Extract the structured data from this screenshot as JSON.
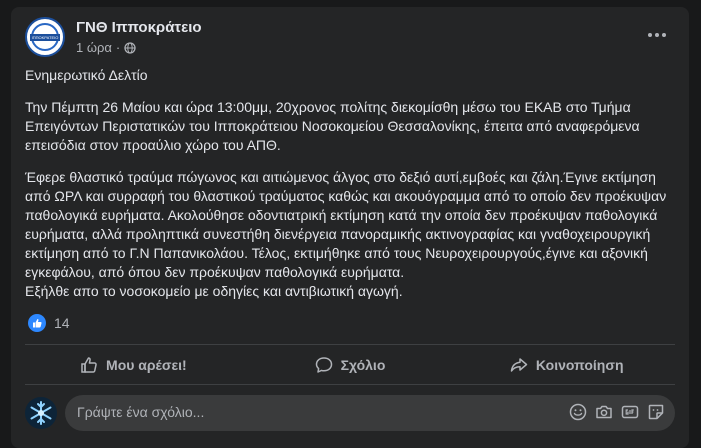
{
  "post": {
    "page_name": "ΓΝΘ Ιπποκράτειο",
    "avatar_text": "ΙΠΠΟΚΡΑΤΕΙΟ",
    "time": "1 ώρα",
    "separator": "·",
    "paragraphs": [
      "Ενημερωτικό Δελτίο",
      "Την Πέμπτη 26 Μαίου και ώρα 13:00μμ, 20χρονος πολίτης διεκομίσθη μέσω του ΕΚΑΒ στο Τμήμα Επειγόντων Περιστατικών του Ιπποκράτειου Νοσοκομείου Θεσσαλονίκης, έπειτα από αναφερόμενα επεισόδια στον προαύλιο χώρο του ΑΠΘ.",
      "Έφερε θλαστικό τραύμα πώγωνος και αιτιώμενος άλγος στο δεξιό αυτί,εμβοές και ζάλη.Έγινε εκτίμηση από ΩΡΛ και συρραφή του θλαστικού τραύματος καθώς και ακουόγραμμα από το οποίο δεν προέκυψαν παθολογικά ευρήματα. Ακολούθησε οδοντιατρική εκτίμηση κατά την οποία δεν προέκυψαν παθολογικά ευρήματα, αλλά προληπτικά συνεστήθη διενέργεια πανοραμικής ακτινογραφίας και γναθοχειρουργική εκτίμηση από το Γ.Ν Παπανικολάου. Τέλος, εκτιμήθηκε από τους Νευροχειρουργούς,έγινε και αξονική εγκεφάλου, από όπου δεν προέκυψαν παθολογικά ευρήματα.",
      "Εξήλθε απο το νοσοκομείο με οδηγίες και αντιβιωτική αγωγή."
    ],
    "reaction_count": "14"
  },
  "actions": {
    "like": "Μου αρέσει!",
    "comment": "Σχόλιο",
    "share": "Κοινοποίηση"
  },
  "composer": {
    "placeholder": "Γράψτε ένα σχόλιο..."
  },
  "colors": {
    "background": "#18191a",
    "card": "#242526",
    "accent": "#2d88ff"
  }
}
